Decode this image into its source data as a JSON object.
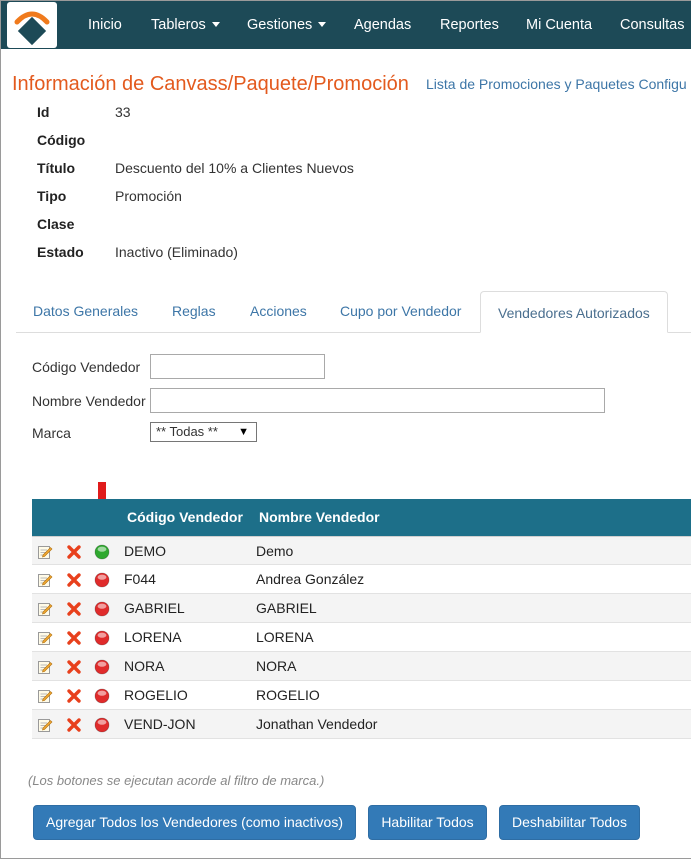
{
  "nav": {
    "items": [
      {
        "label": "Inicio",
        "dropdown": false
      },
      {
        "label": "Tableros",
        "dropdown": true
      },
      {
        "label": "Gestiones",
        "dropdown": true
      },
      {
        "label": "Agendas",
        "dropdown": false
      },
      {
        "label": "Reportes",
        "dropdown": false
      },
      {
        "label": "Mi Cuenta",
        "dropdown": false
      },
      {
        "label": "Consultas",
        "dropdown": false
      }
    ]
  },
  "header": {
    "title": "Información de Canvass/Paquete/Promoción",
    "link": "Lista de Promociones y Paquetes Configu"
  },
  "info": {
    "id_label": "Id",
    "id_value": "33",
    "codigo_label": "Código",
    "codigo_value": "",
    "titulo_label": "Título",
    "titulo_value": "Descuento del 10% a Clientes Nuevos",
    "tipo_label": "Tipo",
    "tipo_value": "Promoción",
    "clase_label": "Clase",
    "clase_value": "",
    "estado_label": "Estado",
    "estado_value": "Inactivo (Eliminado)"
  },
  "tabs": {
    "datos": "Datos Generales",
    "reglas": "Reglas",
    "acciones": "Acciones",
    "cupo": "Cupo por Vendedor",
    "vendedores": "Vendedores Autorizados",
    "active": "vendedores"
  },
  "filters": {
    "codigo_label": "Código Vendedor",
    "codigo_value": "",
    "nombre_label": "Nombre Vendedor",
    "nombre_value": "",
    "marca_label": "Marca",
    "marca_selected": "** Todas **"
  },
  "table": {
    "col_codigo": "Código Vendedor",
    "col_nombre": "Nombre Vendedor",
    "rows": [
      {
        "codigo": "DEMO",
        "nombre": "Demo",
        "status": "active"
      },
      {
        "codigo": "F044",
        "nombre": "Andrea González",
        "status": "inactive"
      },
      {
        "codigo": "GABRIEL",
        "nombre": "GABRIEL",
        "status": "inactive"
      },
      {
        "codigo": "LORENA",
        "nombre": "LORENA",
        "status": "inactive"
      },
      {
        "codigo": "NORA",
        "nombre": "NORA",
        "status": "inactive"
      },
      {
        "codigo": "ROGELIO",
        "nombre": "ROGELIO",
        "status": "inactive"
      },
      {
        "codigo": "VEND-JON",
        "nombre": "Jonathan Vendedor",
        "status": "inactive"
      }
    ]
  },
  "footer": {
    "note": "(Los botones se ejecutan acorde al filtro de marca.)",
    "btn_add_all": "Agregar Todos los Vendedores (como inactivos)",
    "btn_enable_all": "Habilitar Todos",
    "btn_disable_all": "Deshabilitar Todos"
  },
  "colors": {
    "navbar": "#1d4a57",
    "title": "#e35a1e",
    "link": "#3d76a7",
    "table_header": "#1d6f89",
    "button": "#337ab7",
    "status_active": "#2fa82f",
    "status_inactive": "#e02b2b",
    "annotation_arrow": "#e01b1b"
  },
  "icons": {
    "edit": "edit-note-icon",
    "delete": "delete-x-icon",
    "status": "status-dot-icon"
  }
}
